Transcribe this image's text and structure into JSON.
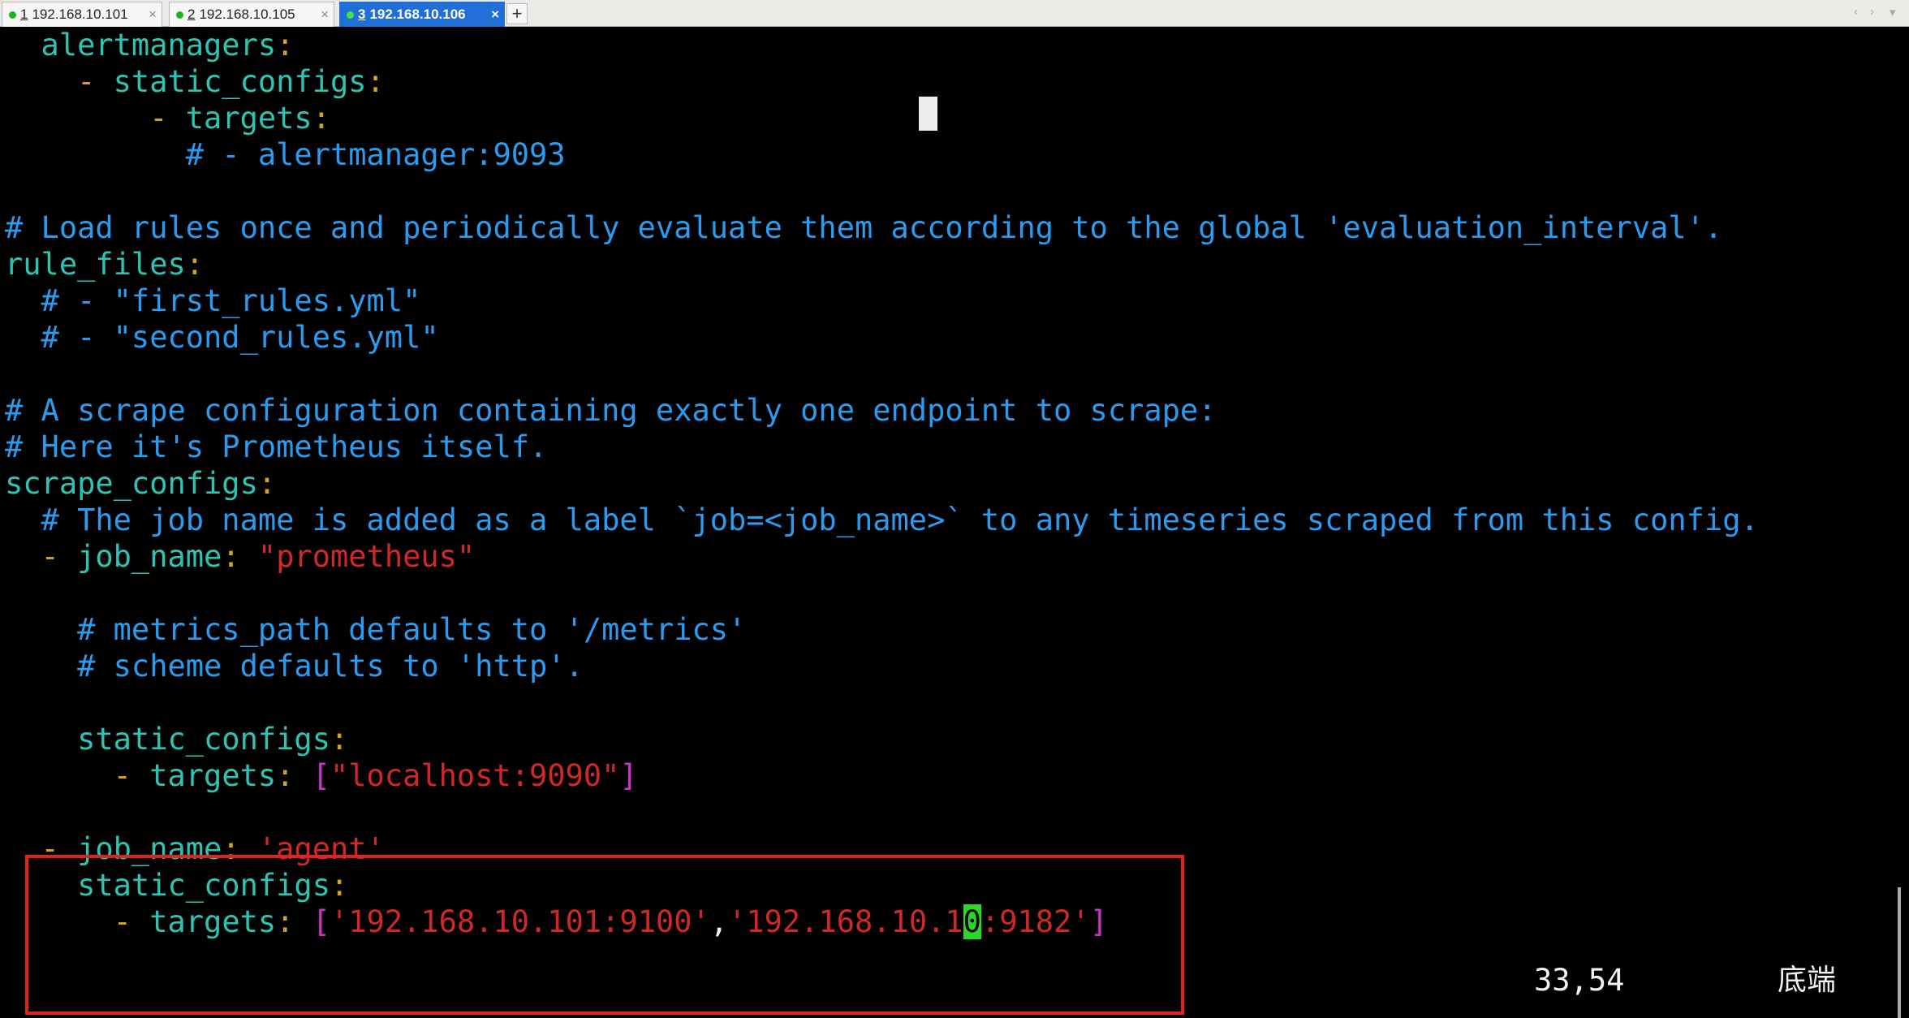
{
  "tabs": [
    {
      "num": "1",
      "label": "192.168.10.101",
      "close": "×"
    },
    {
      "num": "2",
      "label": "192.168.10.105",
      "close": "×"
    },
    {
      "num": "3",
      "label": "192.168.10.106",
      "close": "×"
    }
  ],
  "new_tab": "+",
  "nav": {
    "prev": "‹",
    "next": "›",
    "menu": "▾"
  },
  "status": {
    "position": "33,54",
    "scroll": "底端"
  },
  "colors": {
    "key": "#2ec4b4",
    "punct": "#d6a022",
    "comment": "#2b9bf0",
    "string": "#d02828",
    "bracket": "#c933c9",
    "cursor": "#2cd62c",
    "highlight_box": "#e0231f"
  },
  "lines": [
    [
      [
        "k",
        "  alertmanagers"
      ],
      [
        "p",
        ":"
      ]
    ],
    [
      [
        "p",
        "    - "
      ],
      [
        "k",
        "static_configs"
      ],
      [
        "p",
        ":"
      ]
    ],
    [
      [
        "p",
        "        - "
      ],
      [
        "k",
        "targets"
      ],
      [
        "p",
        ":"
      ]
    ],
    [
      [
        "c",
        "          # - alertmanager:9093"
      ]
    ],
    [],
    [
      [
        "c",
        "# Load rules once and periodically evaluate them according to the global 'evaluation_interval'."
      ]
    ],
    [
      [
        "k",
        "rule_files"
      ],
      [
        "p",
        ":"
      ]
    ],
    [
      [
        "c",
        "  # - \"first_rules.yml\""
      ]
    ],
    [
      [
        "c",
        "  # - \"second_rules.yml\""
      ]
    ],
    [],
    [
      [
        "c",
        "# A scrape configuration containing exactly one endpoint to scrape:"
      ]
    ],
    [
      [
        "c",
        "# Here it's Prometheus itself."
      ]
    ],
    [
      [
        "k",
        "scrape_configs"
      ],
      [
        "p",
        ":"
      ]
    ],
    [
      [
        "c",
        "  # The job name is added as a label `job=<job_name>` to any timeseries scraped from this config."
      ]
    ],
    [
      [
        "p",
        "  - "
      ],
      [
        "k",
        "job_name"
      ],
      [
        "p",
        ": "
      ],
      [
        "s",
        "\"prometheus\""
      ]
    ],
    [],
    [
      [
        "c",
        "    # metrics_path defaults to '/metrics'"
      ]
    ],
    [
      [
        "c",
        "    # scheme defaults to 'http'."
      ]
    ],
    [],
    [
      [
        "k",
        "    static_configs"
      ],
      [
        "p",
        ":"
      ]
    ],
    [
      [
        "p",
        "      - "
      ],
      [
        "k",
        "targets"
      ],
      [
        "p",
        ": "
      ],
      [
        "b",
        "["
      ],
      [
        "s",
        "\"localhost:9090\""
      ],
      [
        "b",
        "]"
      ]
    ],
    [],
    [
      [
        "p",
        "  - "
      ],
      [
        "k",
        "job_name"
      ],
      [
        "p",
        ": "
      ],
      [
        "s",
        "'agent'"
      ]
    ],
    [
      [
        "k",
        "    static_configs"
      ],
      [
        "p",
        ":"
      ]
    ],
    [
      [
        "p",
        "      - "
      ],
      [
        "k",
        "targets"
      ],
      [
        "p",
        ": "
      ],
      [
        "b",
        "["
      ],
      [
        "s",
        "'192.168.10.101:9100'"
      ],
      [
        "w",
        ","
      ],
      [
        "s",
        "'192.168.10.1"
      ],
      [
        "cur",
        "0"
      ],
      [
        "s",
        ":9182'"
      ],
      [
        "b",
        "]"
      ]
    ]
  ]
}
